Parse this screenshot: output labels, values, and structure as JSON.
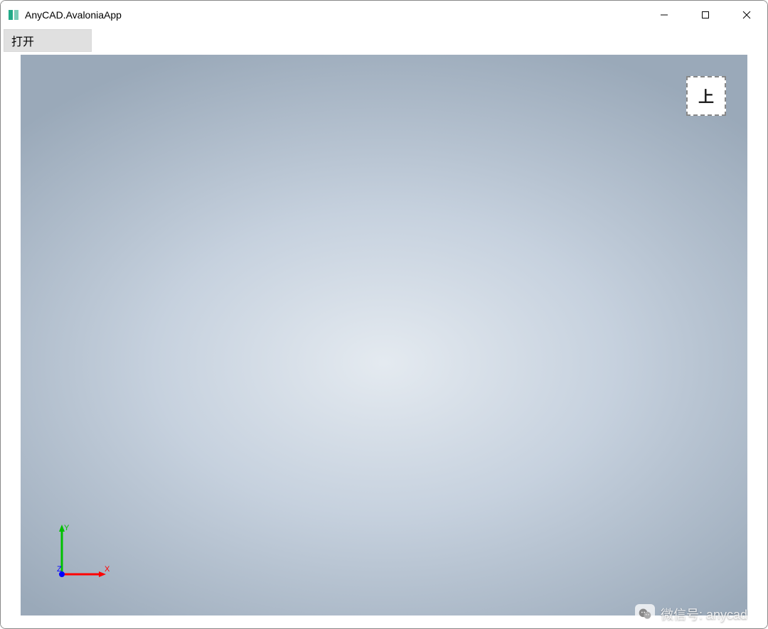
{
  "window": {
    "title": "AnyCAD.AvaloniaApp"
  },
  "menu": {
    "open_label": "打开"
  },
  "viewport": {
    "view_cube_label": "上",
    "axes": {
      "x_label": "X",
      "y_label": "Y",
      "z_label": "Z",
      "x_color": "#ff0000",
      "y_color": "#00c000",
      "z_color": "#0000ff"
    }
  },
  "watermark": {
    "text": "微信号: anycad"
  }
}
